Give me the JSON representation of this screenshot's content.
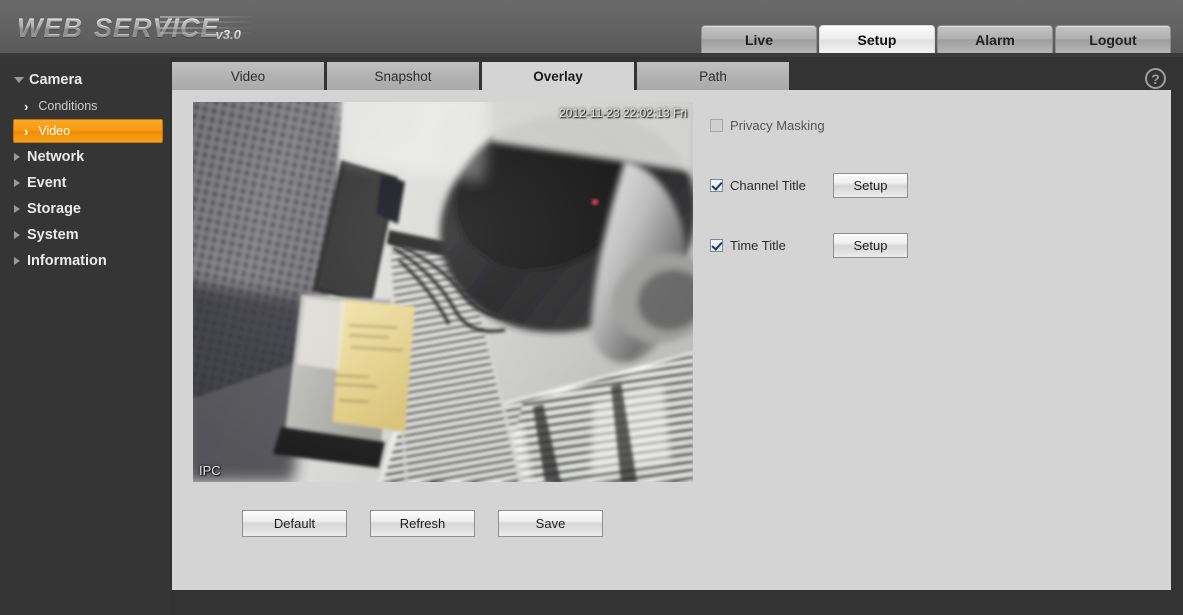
{
  "header": {
    "logo_word1": "WEB",
    "logo_word2": "SERVICE",
    "logo_version": "v3.0"
  },
  "topnav": {
    "items": [
      {
        "label": "Live",
        "active": false
      },
      {
        "label": "Setup",
        "active": true
      },
      {
        "label": "Alarm",
        "active": false
      },
      {
        "label": "Logout",
        "active": false
      }
    ]
  },
  "sidebar": {
    "groups": [
      {
        "label": "Camera",
        "expanded": true,
        "items": [
          {
            "label": "Conditions",
            "active": false
          },
          {
            "label": "Video",
            "active": true
          }
        ]
      },
      {
        "label": "Network",
        "expanded": false,
        "items": []
      },
      {
        "label": "Event",
        "expanded": false,
        "items": []
      },
      {
        "label": "Storage",
        "expanded": false,
        "items": []
      },
      {
        "label": "System",
        "expanded": false,
        "items": []
      },
      {
        "label": "Information",
        "expanded": false,
        "items": []
      }
    ]
  },
  "tabs": [
    {
      "label": "Video",
      "active": false
    },
    {
      "label": "Snapshot",
      "active": false
    },
    {
      "label": "Overlay",
      "active": true
    },
    {
      "label": "Path",
      "active": false
    }
  ],
  "help": {
    "glyph": "?"
  },
  "video": {
    "osd_time": "2012-11-23 22:02:13 Fri",
    "osd_channel": "IPC"
  },
  "controls": {
    "privacy_masking": {
      "label": "Privacy Masking",
      "checked": false
    },
    "channel_title": {
      "label": "Channel Title",
      "checked": true,
      "button": "Setup"
    },
    "time_title": {
      "label": "Time Title",
      "checked": true,
      "button": "Setup"
    }
  },
  "footer": {
    "buttons": [
      {
        "label": "Default"
      },
      {
        "label": "Refresh"
      },
      {
        "label": "Save"
      }
    ]
  },
  "colors": {
    "accent": "#f79a12",
    "sidebar_bg": "#353535",
    "panel_bg": "#d4d4d4",
    "header_bg": "#616161"
  }
}
